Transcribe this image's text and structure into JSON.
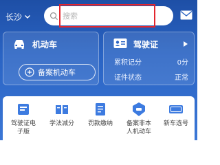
{
  "header": {
    "city": "长沙",
    "search_placeholder": "搜索"
  },
  "vehicle_card": {
    "title": "机动车",
    "add_button": "备案机动车"
  },
  "license_card": {
    "title": "驾驶证",
    "rows": [
      {
        "label": "累积记分",
        "value": "0分"
      },
      {
        "label": "证件状态",
        "value": "正常"
      }
    ]
  },
  "services": [
    {
      "line1": "驾驶证电",
      "line2": "子版",
      "icon": "e-license-icon"
    },
    {
      "line1": "学法减分",
      "line2": "",
      "icon": "book-icon"
    },
    {
      "line1": "罚款缴纳",
      "line2": "",
      "icon": "fine-payment-icon"
    },
    {
      "line1": "备案非本",
      "line2": "人机动车",
      "icon": "record-vehicle-icon"
    },
    {
      "line1": "新车选号",
      "line2": "",
      "icon": "new-plate-icon"
    }
  ],
  "colors": {
    "header_bg": "#2a64c4",
    "highlight_box": "#e3262e",
    "service_icon": "#3d7be0"
  }
}
